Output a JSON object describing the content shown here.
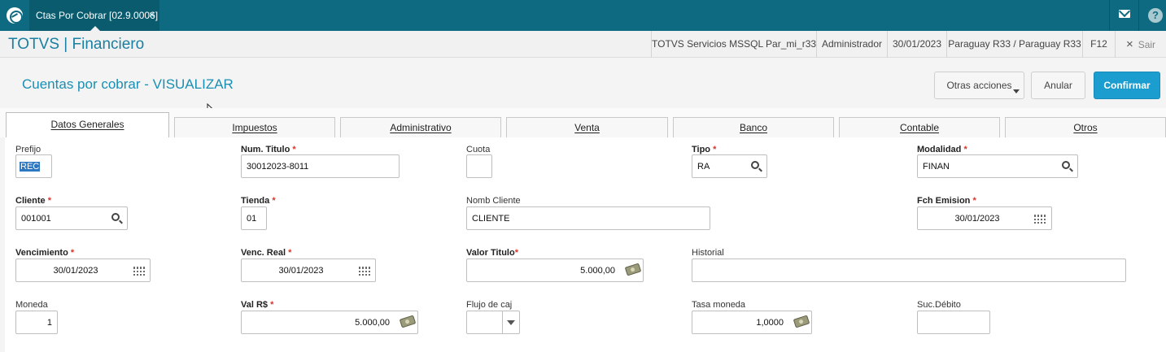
{
  "topbar": {
    "tab_label": "Ctas Por Cobrar [02.9.0006]",
    "tab_close": "×",
    "help": "?"
  },
  "appbar": {
    "title": "TOTVS | Financiero",
    "environment": "TOTVS Servicios MSSQL Par_mi_r33",
    "user": "Administrador",
    "date": "30/01/2023",
    "branch": "Paraguay R33 / Paraguay R33",
    "shortcut": "F12",
    "exit_icon": "×",
    "exit_label": "Sair"
  },
  "header": {
    "page_title": "Cuentas por cobrar - VISUALIZAR",
    "other_actions": "Otras acciones",
    "cancel": "Anular",
    "confirm": "Confirmar"
  },
  "tabs": [
    "Datos Generales",
    "Impuestos",
    "Administrativo",
    "Venta",
    "Banco",
    "Contable",
    "Otros"
  ],
  "form": {
    "prefijo": {
      "label": "Prefijo",
      "value": "REC"
    },
    "num_titulo": {
      "label": "Num. Titulo",
      "value": "30012023-8011"
    },
    "cuota": {
      "label": "Cuota",
      "value": ""
    },
    "tipo": {
      "label": "Tipo",
      "value": "RA"
    },
    "modalidad": {
      "label": "Modalidad",
      "value": "FINAN"
    },
    "cliente": {
      "label": "Cliente",
      "value": "001001"
    },
    "tienda": {
      "label": "Tienda",
      "value": "01"
    },
    "nomb_cliente": {
      "label": "Nomb Cliente",
      "value": "CLIENTE"
    },
    "fch_emision": {
      "label": "Fch Emision",
      "value": "30/01/2023"
    },
    "vencimiento": {
      "label": "Vencimiento",
      "value": "30/01/2023"
    },
    "venc_real": {
      "label": "Venc. Real",
      "value": "30/01/2023"
    },
    "valor_titulo": {
      "label": "Valor Titulo",
      "value": "5.000,00"
    },
    "historial": {
      "label": "Historial",
      "value": ""
    },
    "moneda": {
      "label": "Moneda",
      "value": "1"
    },
    "val_rs": {
      "label": "Val R$",
      "value": "5.000,00"
    },
    "flujo_caja": {
      "label": "Flujo de caj",
      "value": ""
    },
    "tasa_moneda": {
      "label": "Tasa moneda",
      "value": "1,0000"
    },
    "suc_debito": {
      "label": "Suc.Débito",
      "value": ""
    }
  },
  "colors": {
    "topbar": "#0e6a80",
    "accent": "#1a8fb3",
    "confirm": "#1c9dd0",
    "required": "#d9342b"
  }
}
